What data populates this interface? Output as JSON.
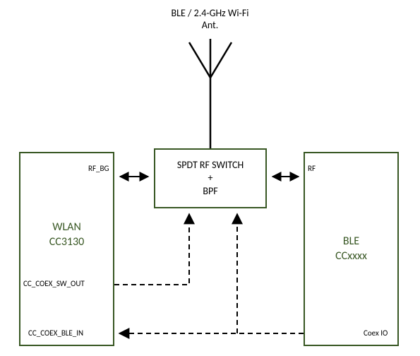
{
  "antenna": {
    "line1": "BLE / 2.4-GHz Wi-Fi",
    "line2": "Ant."
  },
  "switch_box": {
    "line1": "SPDT RF SWITCH",
    "line2": "+",
    "line3": "BPF"
  },
  "wlan_box": {
    "line1": "WLAN",
    "line2": "CC3130"
  },
  "ble_box": {
    "line1": "BLE",
    "line2": "CCxxxx"
  },
  "pins": {
    "rf_bg": "RF_BG",
    "rf": "RF",
    "cc_coex_sw_out": "CC_COEX_SW_OUT",
    "cc_coex_ble_in": "CC_COEX_BLE_IN",
    "coex_io": "Coex IO"
  }
}
